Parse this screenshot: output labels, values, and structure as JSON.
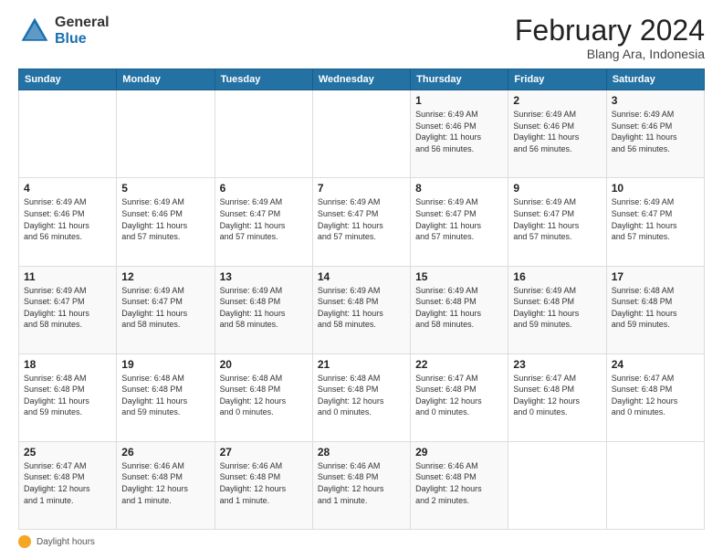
{
  "header": {
    "logo_general": "General",
    "logo_blue": "Blue",
    "month_title": "February 2024",
    "location": "Blang Ara, Indonesia"
  },
  "days_of_week": [
    "Sunday",
    "Monday",
    "Tuesday",
    "Wednesday",
    "Thursday",
    "Friday",
    "Saturday"
  ],
  "weeks": [
    [
      {
        "day": "",
        "detail": ""
      },
      {
        "day": "",
        "detail": ""
      },
      {
        "day": "",
        "detail": ""
      },
      {
        "day": "",
        "detail": ""
      },
      {
        "day": "1",
        "detail": "Sunrise: 6:49 AM\nSunset: 6:46 PM\nDaylight: 11 hours\nand 56 minutes."
      },
      {
        "day": "2",
        "detail": "Sunrise: 6:49 AM\nSunset: 6:46 PM\nDaylight: 11 hours\nand 56 minutes."
      },
      {
        "day": "3",
        "detail": "Sunrise: 6:49 AM\nSunset: 6:46 PM\nDaylight: 11 hours\nand 56 minutes."
      }
    ],
    [
      {
        "day": "4",
        "detail": "Sunrise: 6:49 AM\nSunset: 6:46 PM\nDaylight: 11 hours\nand 56 minutes."
      },
      {
        "day": "5",
        "detail": "Sunrise: 6:49 AM\nSunset: 6:46 PM\nDaylight: 11 hours\nand 57 minutes."
      },
      {
        "day": "6",
        "detail": "Sunrise: 6:49 AM\nSunset: 6:47 PM\nDaylight: 11 hours\nand 57 minutes."
      },
      {
        "day": "7",
        "detail": "Sunrise: 6:49 AM\nSunset: 6:47 PM\nDaylight: 11 hours\nand 57 minutes."
      },
      {
        "day": "8",
        "detail": "Sunrise: 6:49 AM\nSunset: 6:47 PM\nDaylight: 11 hours\nand 57 minutes."
      },
      {
        "day": "9",
        "detail": "Sunrise: 6:49 AM\nSunset: 6:47 PM\nDaylight: 11 hours\nand 57 minutes."
      },
      {
        "day": "10",
        "detail": "Sunrise: 6:49 AM\nSunset: 6:47 PM\nDaylight: 11 hours\nand 57 minutes."
      }
    ],
    [
      {
        "day": "11",
        "detail": "Sunrise: 6:49 AM\nSunset: 6:47 PM\nDaylight: 11 hours\nand 58 minutes."
      },
      {
        "day": "12",
        "detail": "Sunrise: 6:49 AM\nSunset: 6:47 PM\nDaylight: 11 hours\nand 58 minutes."
      },
      {
        "day": "13",
        "detail": "Sunrise: 6:49 AM\nSunset: 6:48 PM\nDaylight: 11 hours\nand 58 minutes."
      },
      {
        "day": "14",
        "detail": "Sunrise: 6:49 AM\nSunset: 6:48 PM\nDaylight: 11 hours\nand 58 minutes."
      },
      {
        "day": "15",
        "detail": "Sunrise: 6:49 AM\nSunset: 6:48 PM\nDaylight: 11 hours\nand 58 minutes."
      },
      {
        "day": "16",
        "detail": "Sunrise: 6:49 AM\nSunset: 6:48 PM\nDaylight: 11 hours\nand 59 minutes."
      },
      {
        "day": "17",
        "detail": "Sunrise: 6:48 AM\nSunset: 6:48 PM\nDaylight: 11 hours\nand 59 minutes."
      }
    ],
    [
      {
        "day": "18",
        "detail": "Sunrise: 6:48 AM\nSunset: 6:48 PM\nDaylight: 11 hours\nand 59 minutes."
      },
      {
        "day": "19",
        "detail": "Sunrise: 6:48 AM\nSunset: 6:48 PM\nDaylight: 11 hours\nand 59 minutes."
      },
      {
        "day": "20",
        "detail": "Sunrise: 6:48 AM\nSunset: 6:48 PM\nDaylight: 12 hours\nand 0 minutes."
      },
      {
        "day": "21",
        "detail": "Sunrise: 6:48 AM\nSunset: 6:48 PM\nDaylight: 12 hours\nand 0 minutes."
      },
      {
        "day": "22",
        "detail": "Sunrise: 6:47 AM\nSunset: 6:48 PM\nDaylight: 12 hours\nand 0 minutes."
      },
      {
        "day": "23",
        "detail": "Sunrise: 6:47 AM\nSunset: 6:48 PM\nDaylight: 12 hours\nand 0 minutes."
      },
      {
        "day": "24",
        "detail": "Sunrise: 6:47 AM\nSunset: 6:48 PM\nDaylight: 12 hours\nand 0 minutes."
      }
    ],
    [
      {
        "day": "25",
        "detail": "Sunrise: 6:47 AM\nSunset: 6:48 PM\nDaylight: 12 hours\nand 1 minute."
      },
      {
        "day": "26",
        "detail": "Sunrise: 6:46 AM\nSunset: 6:48 PM\nDaylight: 12 hours\nand 1 minute."
      },
      {
        "day": "27",
        "detail": "Sunrise: 6:46 AM\nSunset: 6:48 PM\nDaylight: 12 hours\nand 1 minute."
      },
      {
        "day": "28",
        "detail": "Sunrise: 6:46 AM\nSunset: 6:48 PM\nDaylight: 12 hours\nand 1 minute."
      },
      {
        "day": "29",
        "detail": "Sunrise: 6:46 AM\nSunset: 6:48 PM\nDaylight: 12 hours\nand 2 minutes."
      },
      {
        "day": "",
        "detail": ""
      },
      {
        "day": "",
        "detail": ""
      }
    ]
  ],
  "footer": {
    "label": "Daylight hours"
  }
}
